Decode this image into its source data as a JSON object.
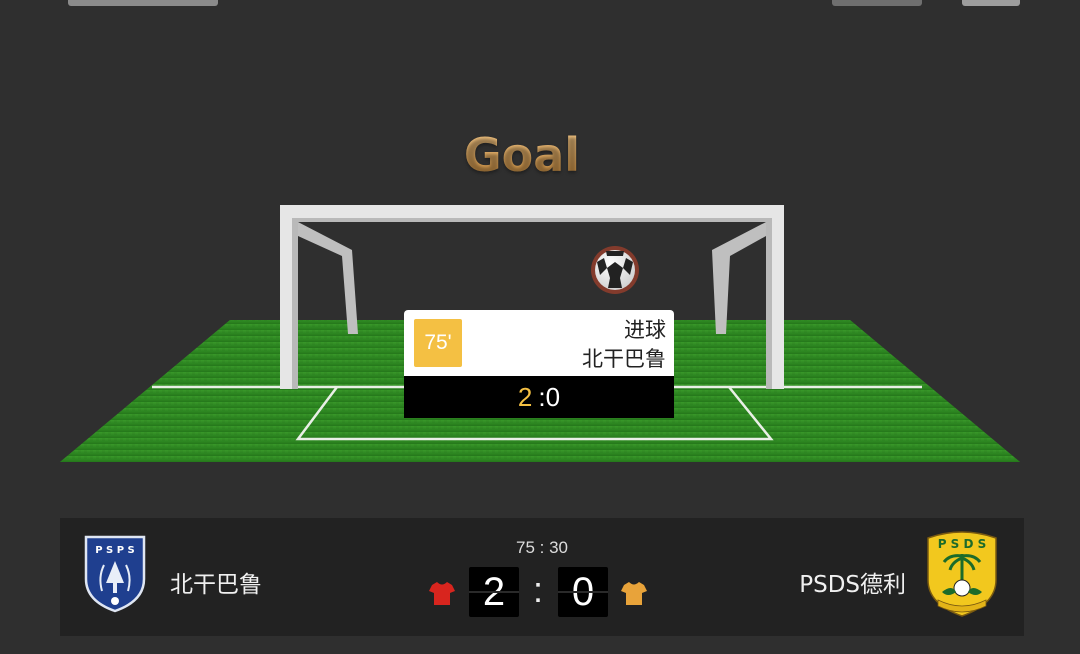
{
  "event": {
    "title": "Goal",
    "minute": "75'",
    "type": "进球",
    "team": "北干巴鲁",
    "score_home": "2",
    "score_sep": ":",
    "score_away": "0"
  },
  "scoreboard": {
    "clock": "75 : 30",
    "home": {
      "name": "北干巴鲁",
      "score": "2",
      "jersey_color": "#d8251e",
      "crest_text": "PSPS"
    },
    "away": {
      "name": "PSDS德利",
      "score": "0",
      "jersey_color": "#e8a33a",
      "crest_text": "PSDS"
    },
    "separator": ":"
  },
  "colors": {
    "background": "#2f2f2f",
    "scoreboard_bg": "#222222",
    "accent_yellow": "#f4c043",
    "title_gold": "#e0a85a",
    "pitch_green": "#2e8a22"
  }
}
